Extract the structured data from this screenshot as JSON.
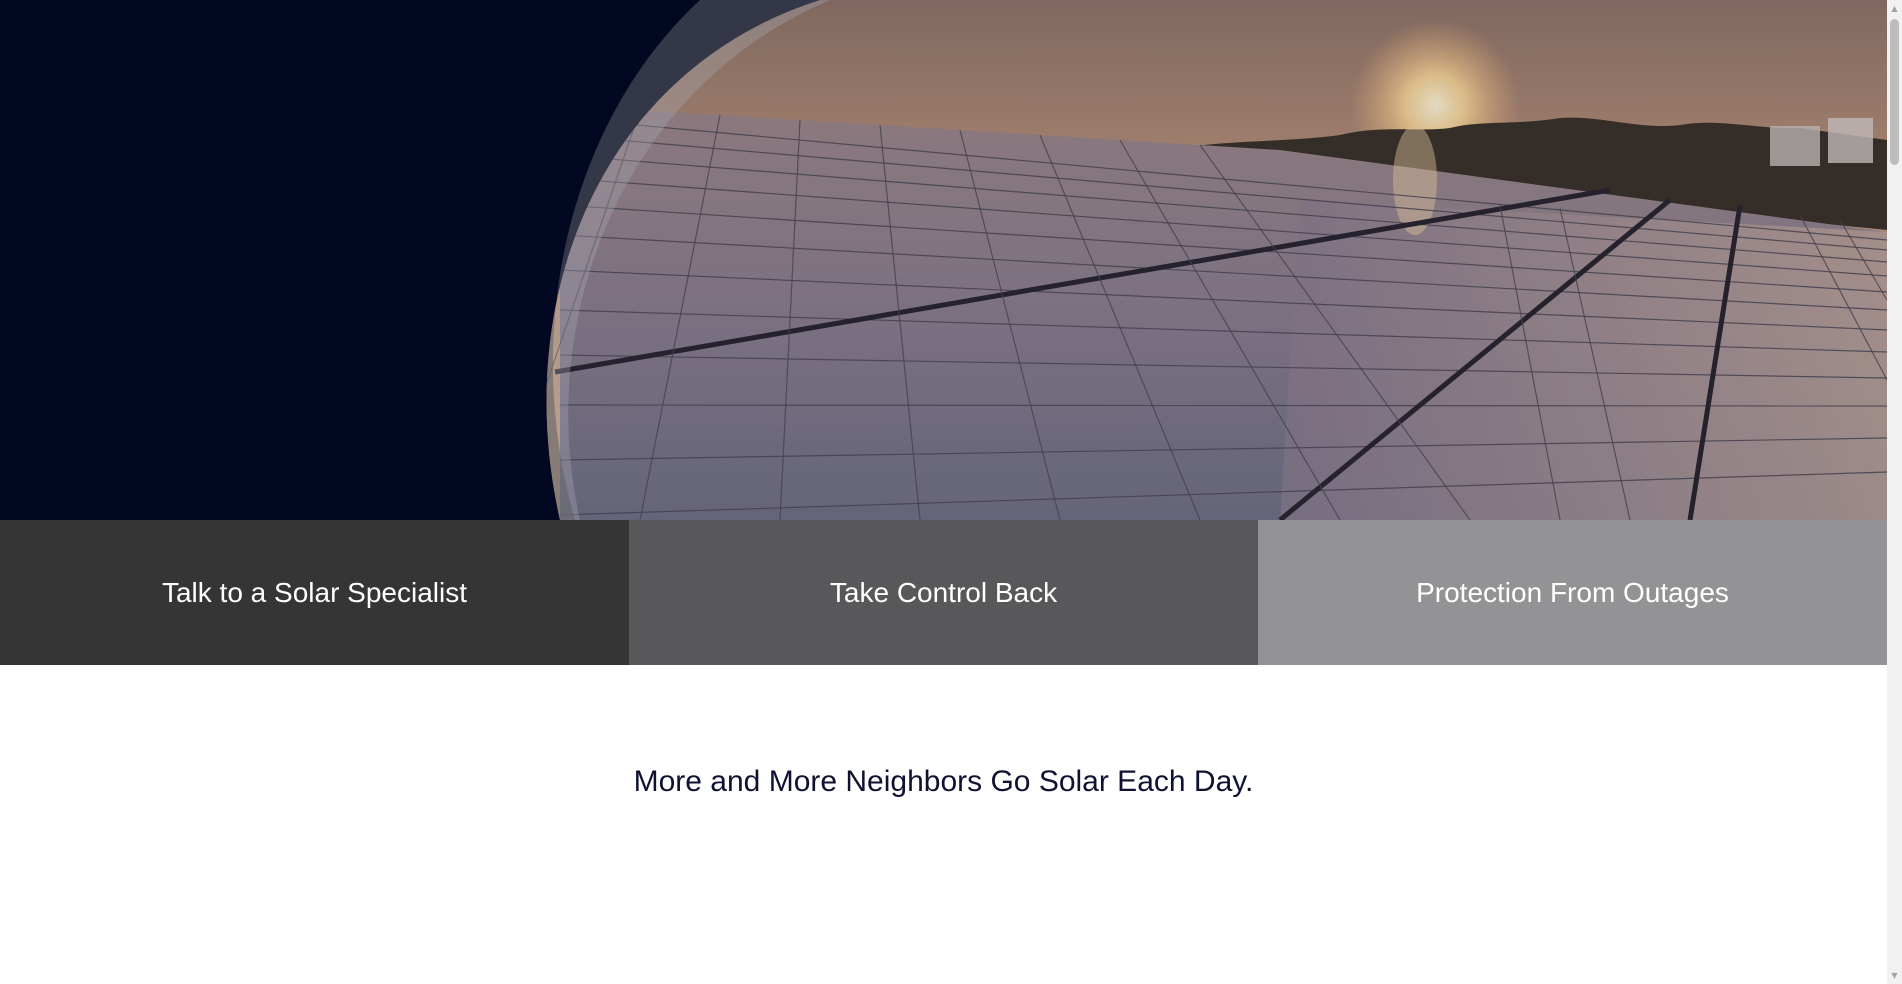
{
  "theme": {
    "hero_navy": "#020822",
    "tile_colors": [
      "#353535",
      "#58585a",
      "#939396"
    ],
    "headline_color": "#0e1230"
  },
  "hero": {
    "image_alt_icon": "solar-panels-sunset-image"
  },
  "features": [
    {
      "label": "Talk to a Solar Specialist"
    },
    {
      "label": "Take Control Back"
    },
    {
      "label": "Protection From Outages"
    }
  ],
  "headline": {
    "text": "More and More Neighbors Go Solar Each Day."
  },
  "scrollbar": {
    "up_icon": "arrow-up-icon",
    "down_icon": "arrow-down-icon"
  }
}
